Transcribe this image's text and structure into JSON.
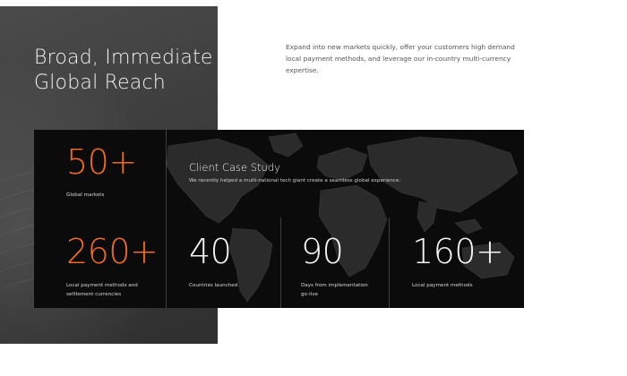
{
  "hero": {
    "title_line1": "Broad, Immediate",
    "title_line2": "Global Reach"
  },
  "intro": {
    "text": "Expand into new markets quickly, offer your customers high demand local payment methods, and leverage our in-country multi-currency expertise."
  },
  "colors": {
    "accent": "#f06a1f",
    "panel_dark": "#0b0b0b",
    "left_panel": "#3d3d3d"
  },
  "stats": {
    "global_markets": {
      "value": "50+",
      "label": "Global markets"
    },
    "payment_methods_currencies": {
      "value": "260+",
      "label": "Local payment methods and settlement currencies"
    }
  },
  "case_study": {
    "title": "Client Case Study",
    "description": "We recently helped a multi-national tech giant create a seamless global experience:",
    "metrics": [
      {
        "value": "40",
        "label": "Countries launched"
      },
      {
        "value": "90",
        "label": "Days from implementation go-live"
      },
      {
        "value": "160+",
        "label": "Local payment methods"
      }
    ]
  }
}
